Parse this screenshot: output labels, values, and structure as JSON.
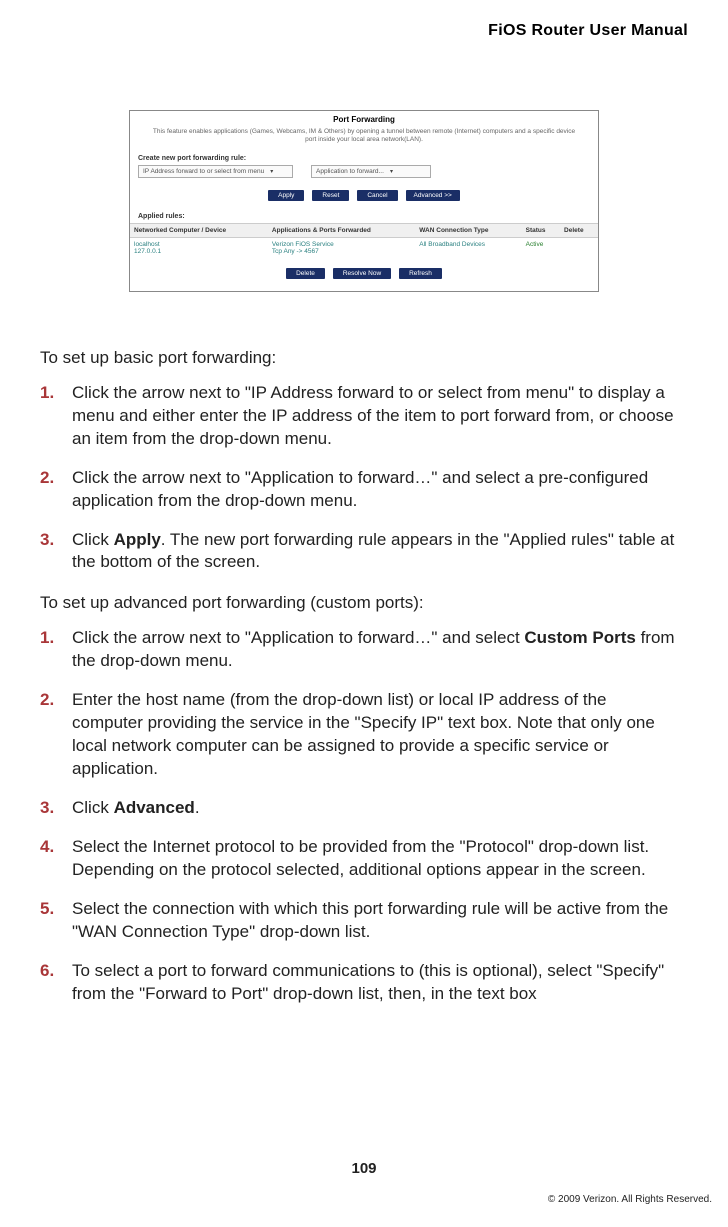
{
  "header": {
    "title": "FiOS Router User Manual"
  },
  "screenshot": {
    "panel_title": "Port Forwarding",
    "panel_desc": "This feature enables applications (Games, Webcams, IM & Others) by opening a tunnel between remote (Internet) computers and a specific device port inside your local area network(LAN).",
    "create_label": "Create new port forwarding rule:",
    "dd_ip": "IP Address forward to or select from menu",
    "dd_app": "Application to forward...",
    "buttons_top": {
      "apply": "Apply",
      "reset": "Reset",
      "cancel": "Cancel",
      "advanced": "Advanced >>"
    },
    "applied_label": "Applied rules:",
    "table": {
      "headers": {
        "c1": "Networked Computer / Device",
        "c2": "Applications & Ports Forwarded",
        "c3": "WAN Connection Type",
        "c4": "Status",
        "c5": "Delete"
      },
      "row": {
        "host": "localhost",
        "ip": "127.0.0.1",
        "app": "Verizon FiOS Service",
        "ports": "Tcp Any -> 4567",
        "wan": "All Broadband Devices",
        "status": "Active"
      }
    },
    "buttons_bottom": {
      "delete": "Delete",
      "resolve": "Resolve Now",
      "refresh": "Refresh"
    }
  },
  "body": {
    "intro1": "To set up basic port forwarding:",
    "basic": {
      "s1": "Click the arrow next to \"IP Address forward to or select from menu\" to display  a menu and either enter the IP address of the item to port forward from, or choose an item from the drop-down menu.",
      "s2": "Click the arrow next to \"Application to forward…\" and select a pre-configured application from the drop-down menu.",
      "s3a": "Click ",
      "s3b": "Apply",
      "s3c": ". The new port forwarding rule appears in the \"Applied rules\" table at the bottom of the screen."
    },
    "intro2": "To set up advanced port forwarding (custom ports):",
    "adv": {
      "s1a": "Click the arrow next to \"Application to forward…\" and select ",
      "s1b": "Custom Ports",
      "s1c": " from the drop-down menu.",
      "s2": "Enter the host name (from the drop-down list) or local IP address of the computer providing the service in the \"Specify IP\" text box. Note that only one local network computer can be assigned to provide a specific service or application.",
      "s3a": "Click ",
      "s3b": "Advanced",
      "s3c": ".",
      "s4": "Select the Internet protocol to be provided from the \"Protocol\" drop-down list.  Depending on the protocol selected, additional options appear in the screen.",
      "s5": "Select the connection with which this port forwarding rule will be active from the \"WAN Connection Type\" drop-down list.",
      "s6": "To select a port to forward communications to (this is optional), select \"Specify\" from the \"Forward to Port\" drop-down list, then, in the text box"
    }
  },
  "footer": {
    "page": "109",
    "copyright": "© 2009 Verizon. All Rights Reserved."
  },
  "nums": {
    "n1": "1.",
    "n2": "2.",
    "n3": "3.",
    "n4": "4.",
    "n5": "5.",
    "n6": "6."
  },
  "glyphs": {
    "dd_arrow": "▾"
  }
}
